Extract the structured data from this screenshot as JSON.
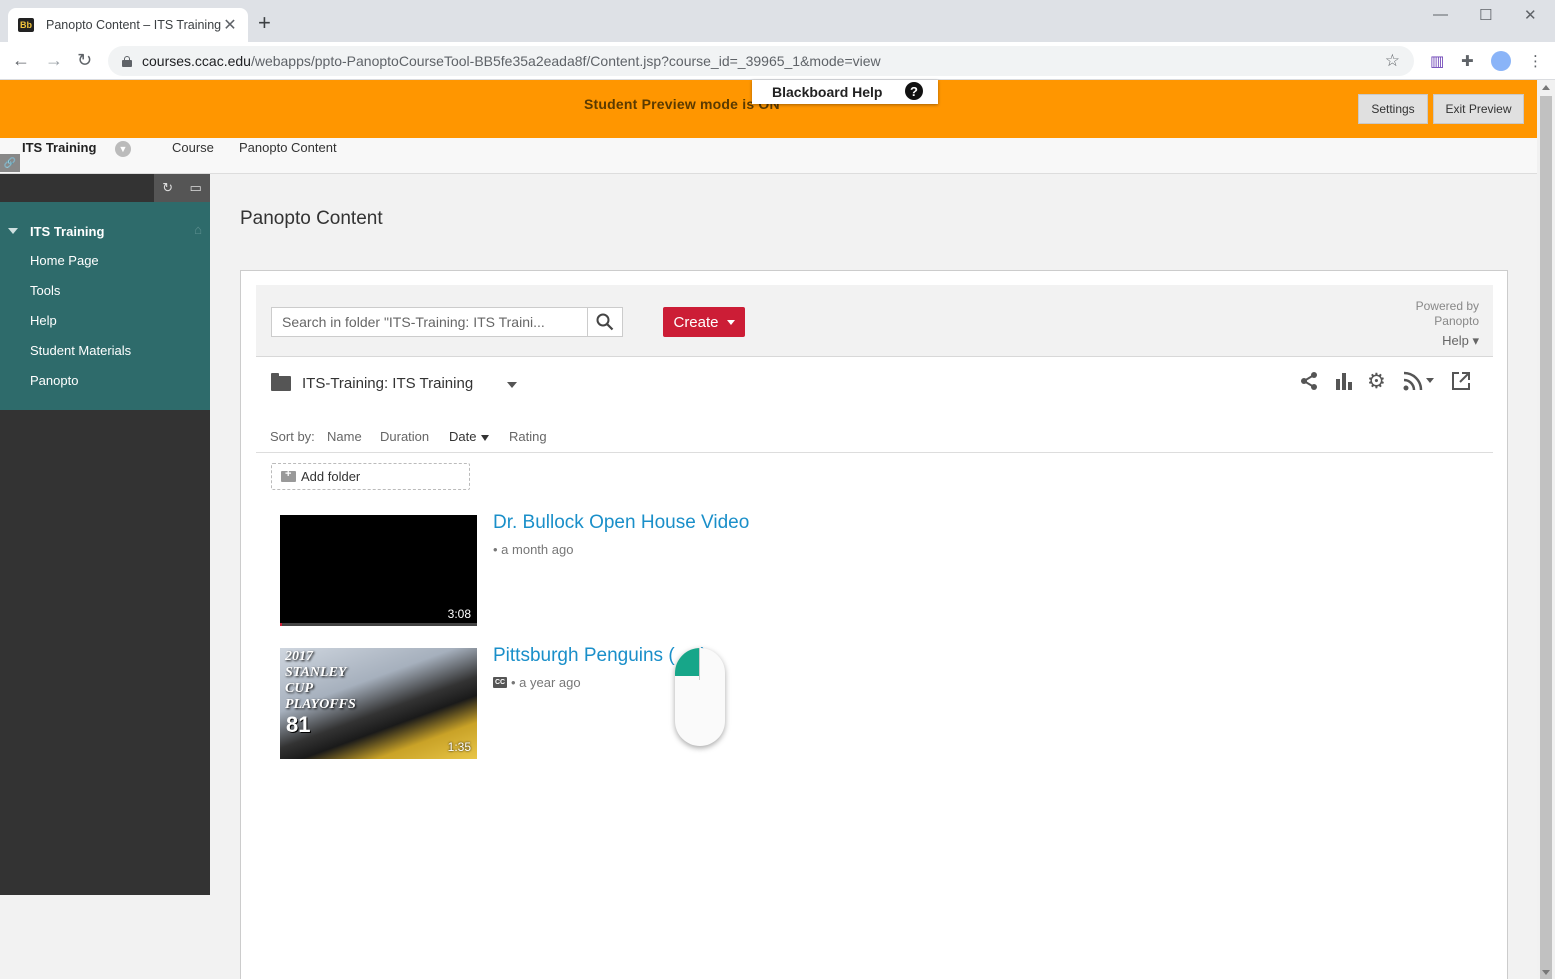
{
  "browser": {
    "tab_title": "Panopto Content – ITS Training",
    "tab_favicon": "Bb",
    "url_host": "courses.ccac.edu",
    "url_path": "/webapps/ppto-PanoptoCourseTool-BB5fe35a2eada8f/Content.jsp?course_id=_39965_1&mode=view"
  },
  "preview": {
    "message": "Student Preview mode is ON",
    "help_tab": "Blackboard Help",
    "settings_label": "Settings",
    "exit_label": "Exit Preview"
  },
  "course": {
    "name": "ITS Training",
    "breadcrumb": [
      "Course",
      "Panopto Content"
    ]
  },
  "menu": {
    "title": "ITS Training",
    "items": [
      "Home Page",
      "Tools",
      "Help",
      "Student Materials",
      "Panopto"
    ]
  },
  "page": {
    "title": "Panopto Content"
  },
  "panopto": {
    "search_placeholder": "Search in folder \"ITS-Training: ITS Traini...",
    "create_label": "Create",
    "powered_line1": "Powered by",
    "powered_line2": "Panopto",
    "help_label": "Help",
    "folder_name": "ITS-Training: ITS Training",
    "sort_label": "Sort by:",
    "sort_options": [
      "Name",
      "Duration",
      "Date",
      "Rating"
    ],
    "sort_active": "Date",
    "add_folder_label": "Add folder",
    "sessions": [
      {
        "title": "Dr. Bullock Open House Video",
        "meta": "• a month ago",
        "duration": "3:08",
        "captions": false
      },
      {
        "title": "Pittsburgh Penguins (",
        "title_end": ")",
        "meta": "• a year ago",
        "duration": "1:35",
        "captions": true,
        "thumb_text": "2017\nSTANLEY\nCUP\nPLAYOFFS",
        "thumb_number": "81"
      }
    ]
  },
  "colors": {
    "preview_bar": "#ff9600",
    "menu_teal": "#2e6b6b",
    "create_red": "#cc1d36",
    "link_blue": "#1a8fc9"
  }
}
